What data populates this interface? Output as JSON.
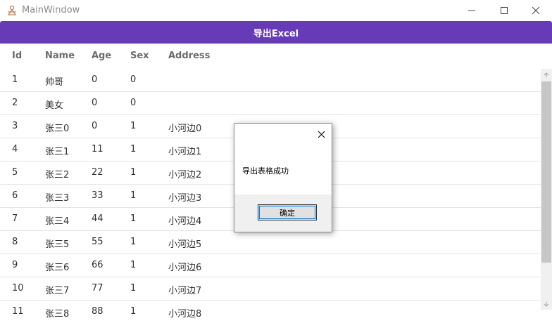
{
  "window": {
    "title": "MainWindow",
    "icons": {
      "app": "app-icon",
      "minimize": "minimize-icon",
      "maximize": "maximize-icon",
      "close": "close-icon"
    }
  },
  "toolbar": {
    "export_label": "导出Excel",
    "accent": "#673ab7"
  },
  "table": {
    "columns": [
      "Id",
      "Name",
      "Age",
      "Sex",
      "Address"
    ],
    "rows": [
      [
        "1",
        "帅哥",
        "0",
        "0",
        ""
      ],
      [
        "2",
        "美女",
        "0",
        "0",
        ""
      ],
      [
        "3",
        "张三0",
        "0",
        "1",
        "小河边0"
      ],
      [
        "4",
        "张三1",
        "11",
        "1",
        "小河边1"
      ],
      [
        "5",
        "张三2",
        "22",
        "1",
        "小河边2"
      ],
      [
        "6",
        "张三3",
        "33",
        "1",
        "小河边3"
      ],
      [
        "7",
        "张三4",
        "44",
        "1",
        "小河边4"
      ],
      [
        "8",
        "张三5",
        "55",
        "1",
        "小河边5"
      ],
      [
        "9",
        "张三6",
        "66",
        "1",
        "小河边6"
      ],
      [
        "10",
        "张三7",
        "77",
        "1",
        "小河边7"
      ],
      [
        "11",
        "张三8",
        "88",
        "1",
        "小河边8"
      ]
    ]
  },
  "dialog": {
    "message": "导出表格成功",
    "ok_label": "确定",
    "close_icon": "close-icon"
  }
}
